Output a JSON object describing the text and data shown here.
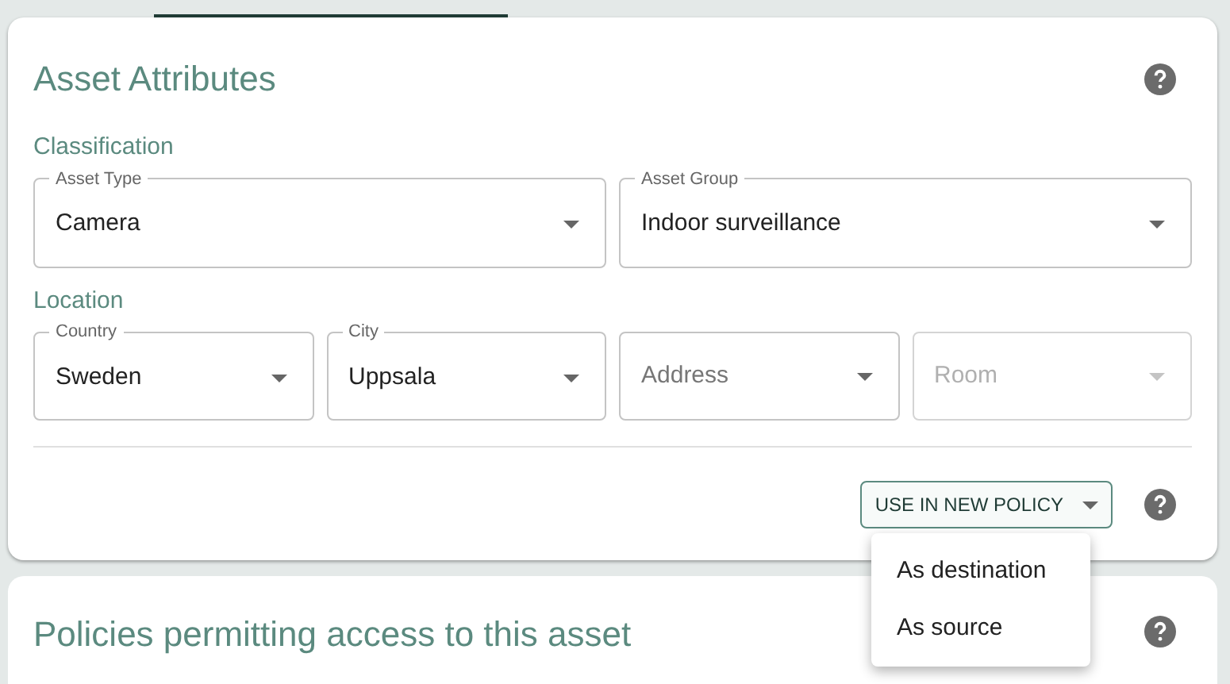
{
  "asset_attributes": {
    "title": "Asset Attributes",
    "sections": [
      {
        "heading": "Classification",
        "fields": [
          {
            "label": "Asset Type",
            "value": "Camera",
            "disabled": false
          },
          {
            "label": "Asset Group",
            "value": "Indoor surveillance",
            "disabled": false
          }
        ]
      },
      {
        "heading": "Location",
        "fields": [
          {
            "label": "Country",
            "value": "Sweden",
            "disabled": false
          },
          {
            "label": "City",
            "value": "Uppsala",
            "disabled": false
          },
          {
            "placeholder": "Address",
            "disabled": false
          },
          {
            "placeholder": "Room",
            "disabled": true
          }
        ]
      }
    ],
    "policy_button": {
      "label": "USE IN NEW POLICY",
      "expanded": true
    },
    "menu": [
      "As destination",
      "As source"
    ]
  },
  "policies": {
    "title": "Policies permitting access to this asset"
  }
}
